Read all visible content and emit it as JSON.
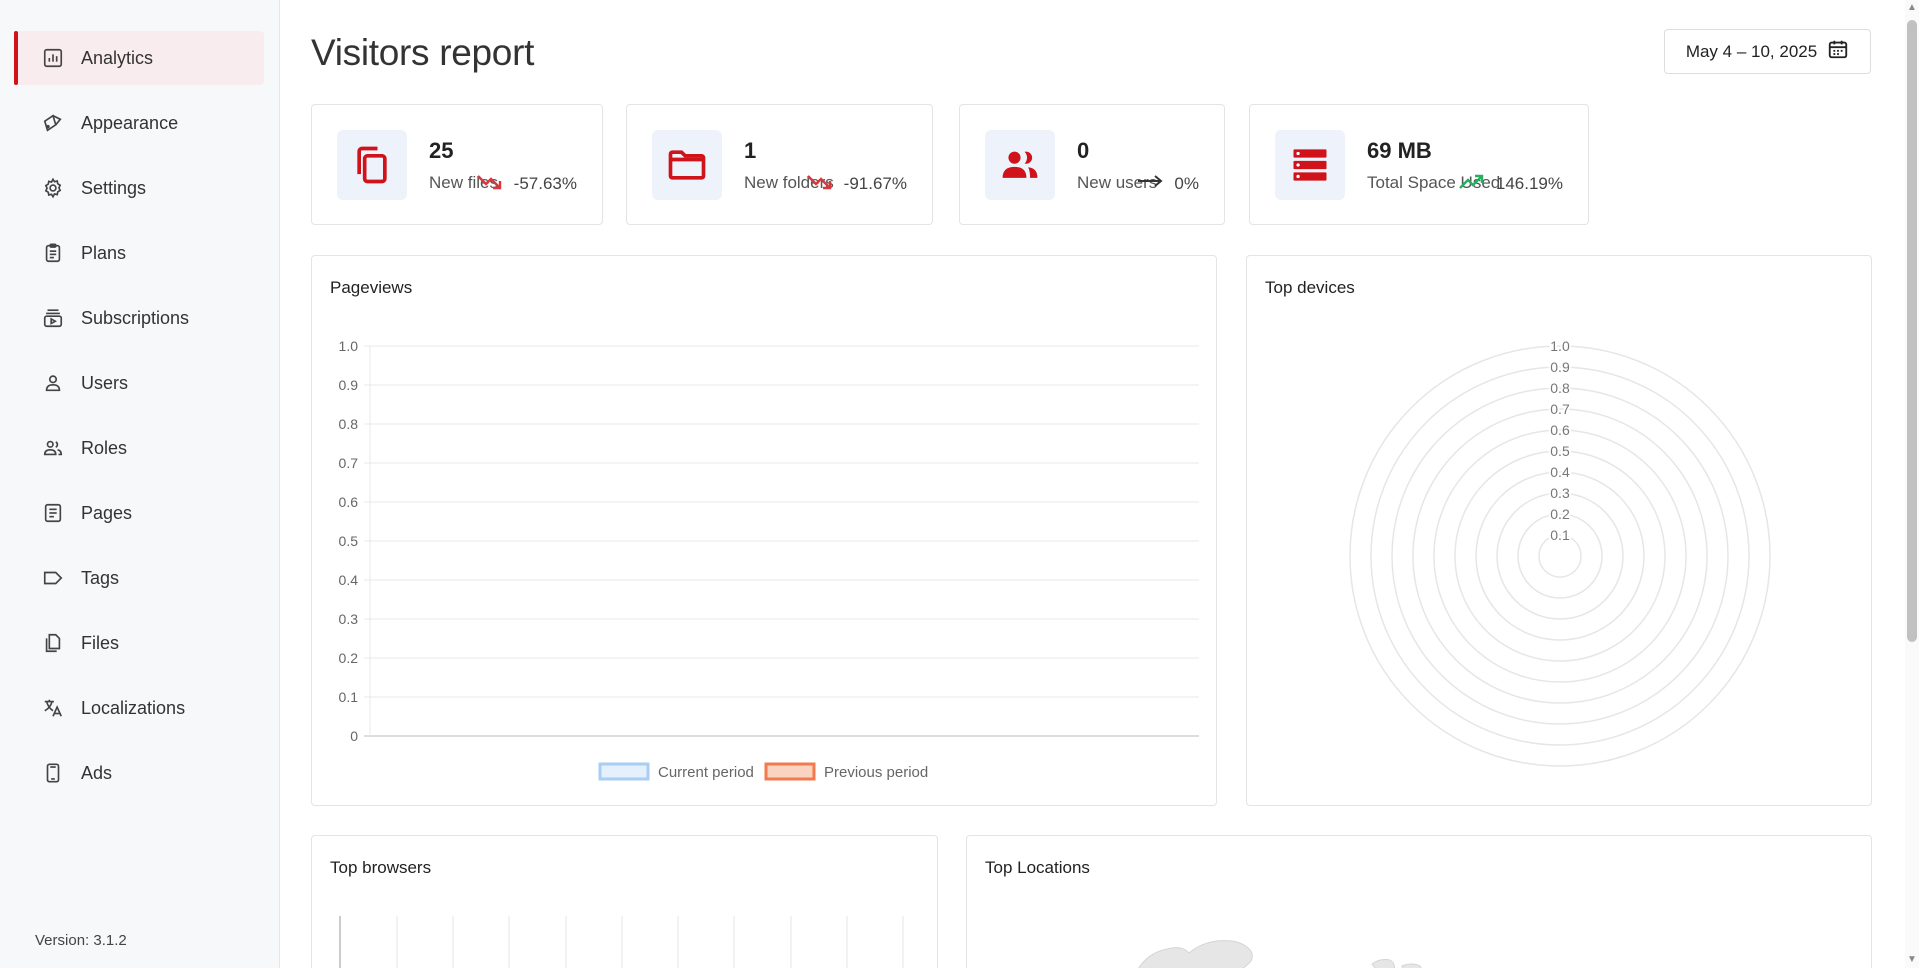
{
  "sidebar": {
    "items": [
      {
        "label": "Analytics",
        "icon": "chart-icon",
        "active": true
      },
      {
        "label": "Appearance",
        "icon": "brush-icon"
      },
      {
        "label": "Settings",
        "icon": "gear-icon"
      },
      {
        "label": "Plans",
        "icon": "clipboard-icon"
      },
      {
        "label": "Subscriptions",
        "icon": "subscriptions-icon"
      },
      {
        "label": "Users",
        "icon": "user-icon"
      },
      {
        "label": "Roles",
        "icon": "group-icon"
      },
      {
        "label": "Pages",
        "icon": "page-icon"
      },
      {
        "label": "Tags",
        "icon": "tag-icon"
      },
      {
        "label": "Files",
        "icon": "files-icon"
      },
      {
        "label": "Localizations",
        "icon": "translate-icon"
      },
      {
        "label": "Ads",
        "icon": "phone-icon"
      }
    ],
    "version": "Version: 3.1.2"
  },
  "header": {
    "title": "Visitors report",
    "date_range": "May 4 – 10, 2025"
  },
  "stats": [
    {
      "value": "25",
      "label": "New files",
      "change": "-57.63%",
      "trend": "down",
      "icon": "copy-icon"
    },
    {
      "value": "1",
      "label": "New folders",
      "change": "-91.67%",
      "trend": "down",
      "icon": "folder-icon"
    },
    {
      "value": "0",
      "label": "New users",
      "change": "0%",
      "trend": "flat",
      "icon": "users-icon"
    },
    {
      "value": "69 MB",
      "label": "Total Space Used",
      "change": "146.19%",
      "trend": "up",
      "icon": "storage-icon"
    }
  ],
  "cards": {
    "pageviews": "Pageviews",
    "devices": "Top devices",
    "browsers": "Top browsers",
    "locations": "Top Locations"
  },
  "colors": {
    "accent": "#d0121b",
    "down": "#d9363e",
    "up": "#27ae60",
    "current_period": "#a9cdf5",
    "previous_period": "#f27b4e"
  },
  "chart_data": [
    {
      "type": "line",
      "title": "Pageviews",
      "y_ticks": [
        "0",
        "0.1",
        "0.2",
        "0.3",
        "0.4",
        "0.5",
        "0.6",
        "0.7",
        "0.8",
        "0.9",
        "1.0"
      ],
      "ylim": [
        0,
        1
      ],
      "series": [
        {
          "name": "Current period",
          "values": []
        },
        {
          "name": "Previous period",
          "values": []
        }
      ],
      "legend": "bottom",
      "grid": true
    },
    {
      "type": "radar",
      "title": "Top devices",
      "r_ticks": [
        "0.1",
        "0.2",
        "0.3",
        "0.4",
        "0.5",
        "0.6",
        "0.7",
        "0.8",
        "0.9",
        "1.0"
      ],
      "rlim": [
        0,
        1
      ],
      "series": [],
      "grid": true
    }
  ]
}
